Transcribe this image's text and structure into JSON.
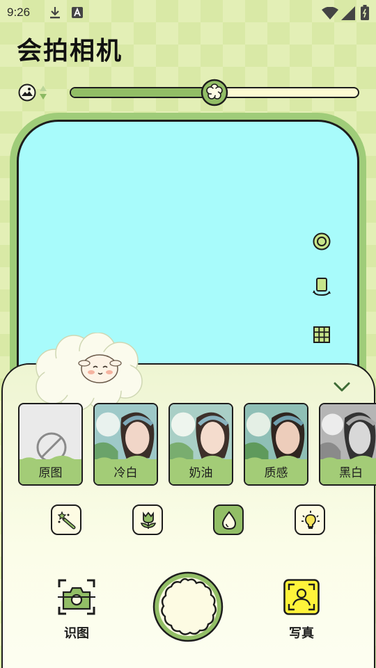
{
  "status_bar": {
    "time": "9:26",
    "icons": [
      "download-icon",
      "a-notification-icon",
      "wifi-icon",
      "signal-icon",
      "battery-icon"
    ]
  },
  "header": {
    "title": "会拍相机"
  },
  "intensity_slider": {
    "value_fraction": 0.5
  },
  "viewfinder": {
    "tools": [
      "circle-shutter-icon",
      "rotate-camera-icon",
      "grid-icon"
    ]
  },
  "filters": [
    {
      "label": "原图",
      "type": "none"
    },
    {
      "label": "冷白",
      "type": "photo"
    },
    {
      "label": "奶油",
      "type": "photo"
    },
    {
      "label": "质感",
      "type": "photo"
    },
    {
      "label": "黑白",
      "type": "photo"
    }
  ],
  "tools": [
    {
      "icon": "magic-wand-icon",
      "active": false
    },
    {
      "icon": "tulip-icon",
      "active": false
    },
    {
      "icon": "water-drop-icon",
      "active": true
    },
    {
      "icon": "lightbulb-icon",
      "active": false
    }
  ],
  "actions": {
    "left_label": "识图",
    "right_label": "写真"
  },
  "colors": {
    "accent_green": "#92be66",
    "viewfinder_cyan": "#a8fbfb",
    "cream": "#fdfbd2",
    "portrait_yellow": "#fff33a"
  }
}
